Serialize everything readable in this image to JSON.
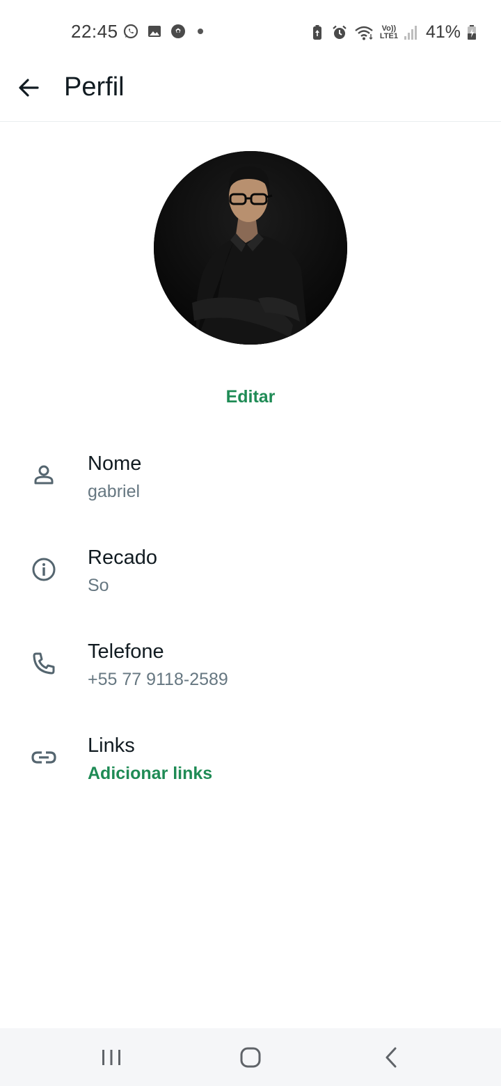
{
  "status_bar": {
    "time": "22:45",
    "left_icons": [
      "whatsapp-icon",
      "gallery-icon",
      "soccer-ball-icon",
      "notification-dot"
    ],
    "right_icons": [
      "battery-saver-icon",
      "alarm-icon",
      "wifi-icon",
      "volte-icon",
      "signal-icon",
      "battery-icon"
    ],
    "volte_top": "Vo))",
    "volte_bottom": "LTE1",
    "battery": "41%"
  },
  "app_bar": {
    "back_icon": "arrow-back-icon",
    "title": "Perfil"
  },
  "profile": {
    "edit_label": "Editar"
  },
  "fields": [
    {
      "icon": "person-icon",
      "label": "Nome",
      "value": "gabriel"
    },
    {
      "icon": "info-icon",
      "label": "Recado",
      "value": "So"
    },
    {
      "icon": "phone-icon",
      "label": "Telefone",
      "value": "+55 77 9118-2589"
    },
    {
      "icon": "link-icon",
      "label": "Links",
      "value": "Adicionar links"
    }
  ],
  "nav_bar": {
    "icons": [
      "recent-apps-icon",
      "home-icon",
      "back-nav-icon"
    ]
  },
  "colors": {
    "accent": "#1f8b55",
    "secondary_text": "#667781",
    "primary_text": "#111b21",
    "nav_background": "#f5f6f8"
  }
}
